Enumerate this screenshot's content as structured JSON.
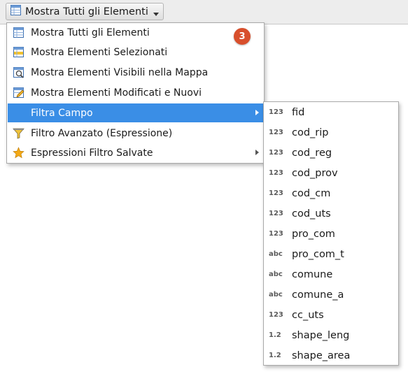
{
  "toolbar": {
    "filter_button_label": "Mostra Tutti gli Elementi",
    "filter_button_icon": "table-icon"
  },
  "badge": {
    "text": "3",
    "color": "#d84f2c"
  },
  "menu": {
    "items": [
      {
        "label": "Mostra Tutti gli Elementi",
        "icon": "table-icon"
      },
      {
        "label": "Mostra Elementi Selezionati",
        "icon": "table-selected-icon"
      },
      {
        "label": "Mostra Elementi Visibili nella Mappa",
        "icon": "table-visible-icon"
      },
      {
        "label": "Mostra Elementi Modificati e Nuovi",
        "icon": "table-edited-icon"
      },
      {
        "label": "Filtra Campo",
        "icon": "",
        "submenu": true,
        "active": true
      },
      {
        "label": "Filtro Avanzato (Espressione)",
        "icon": "funnel-icon"
      },
      {
        "label": "Espressioni Filtro Salvate",
        "icon": "star-icon",
        "submenu": true
      }
    ],
    "active_color": "#3a8ee6"
  },
  "fields": {
    "items": [
      {
        "type": "123",
        "name": "fid"
      },
      {
        "type": "123",
        "name": "cod_rip"
      },
      {
        "type": "123",
        "name": "cod_reg"
      },
      {
        "type": "123",
        "name": "cod_prov"
      },
      {
        "type": "123",
        "name": "cod_cm"
      },
      {
        "type": "123",
        "name": "cod_uts"
      },
      {
        "type": "123",
        "name": "pro_com"
      },
      {
        "type": "abc",
        "name": "pro_com_t"
      },
      {
        "type": "abc",
        "name": "comune"
      },
      {
        "type": "abc",
        "name": "comune_a"
      },
      {
        "type": "123",
        "name": "cc_uts"
      },
      {
        "type": "1.2",
        "name": "shape_leng"
      },
      {
        "type": "1.2",
        "name": "shape_area"
      }
    ]
  }
}
